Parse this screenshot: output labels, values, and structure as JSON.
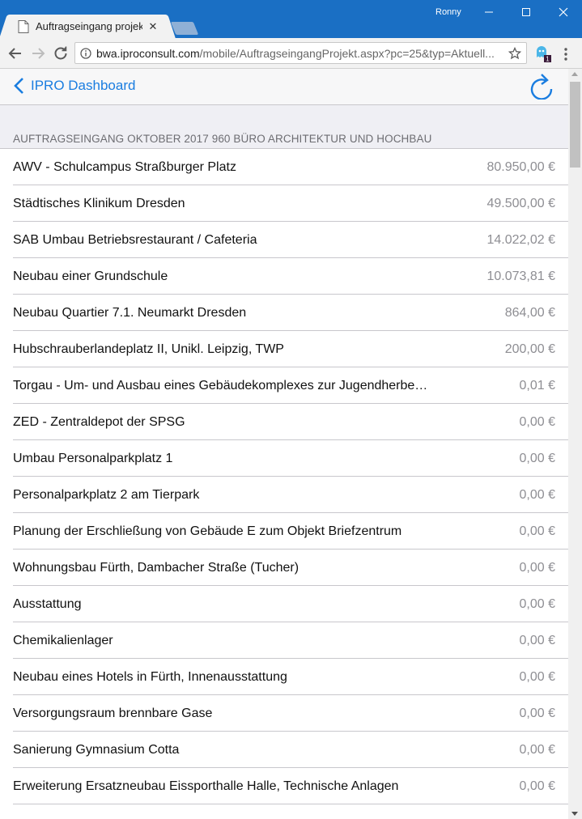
{
  "browser": {
    "tab_title": "Auftragseingang projekte",
    "tab_close": "✕",
    "user_name": "Ronny",
    "url_host": "bwa.iproconsult.com",
    "url_path": "/mobile/AuftragseingangProjekt.aspx?pc=25&typ=Aktuell...",
    "extension_badge": "1"
  },
  "navbar": {
    "back_label": "IPRO Dashboard"
  },
  "section": {
    "header": "AUFTRAGSEINGANG OKTOBER 2017 960 BÜRO ARCHITEKTUR UND HOCHBAU"
  },
  "rows": [
    {
      "label": "AWV - Schulcampus Straßburger Platz",
      "value": "80.950,00 €"
    },
    {
      "label": "Städtisches Klinikum Dresden",
      "value": "49.500,00 €"
    },
    {
      "label": "SAB Umbau Betriebsrestaurant / Cafeteria",
      "value": "14.022,02 €"
    },
    {
      "label": "Neubau einer Grundschule",
      "value": "10.073,81 €"
    },
    {
      "label": "Neubau Quartier 7.1. Neumarkt Dresden",
      "value": "864,00 €"
    },
    {
      "label": "Hubschrauberlandeplatz II, Unikl. Leipzig, TWP",
      "value": "200,00 €"
    },
    {
      "label": "Torgau - Um- und Ausbau eines Gebäudekomplexes zur Jugendherbe…",
      "value": "0,01 €"
    },
    {
      "label": "ZED - Zentraldepot der SPSG",
      "value": "0,00 €"
    },
    {
      "label": "Umbau Personalparkplatz 1",
      "value": "0,00 €"
    },
    {
      "label": "Personalparkplatz 2 am Tierpark",
      "value": "0,00 €"
    },
    {
      "label": "Planung der Erschließung von Gebäude E zum Objekt Briefzentrum",
      "value": "0,00 €"
    },
    {
      "label": "Wohnungsbau Fürth, Dambacher Straße (Tucher)",
      "value": "0,00 €"
    },
    {
      "label": "Ausstattung",
      "value": "0,00 €"
    },
    {
      "label": "Chemikalienlager",
      "value": "0,00 €"
    },
    {
      "label": "Neubau eines Hotels in Fürth, Innenausstattung",
      "value": "0,00 €"
    },
    {
      "label": "Versorgungsraum brennbare Gase",
      "value": "0,00 €"
    },
    {
      "label": "Sanierung Gymnasium Cotta",
      "value": "0,00 €"
    },
    {
      "label": "Erweiterung Ersatzneubau Eissporthalle Halle, Technische Anlagen",
      "value": "0,00 €"
    }
  ],
  "colors": {
    "titlebar": "#1a6fc4",
    "link_blue": "#1a7de0",
    "value_gray": "#8e8e93",
    "section_bg": "#efeff4"
  }
}
